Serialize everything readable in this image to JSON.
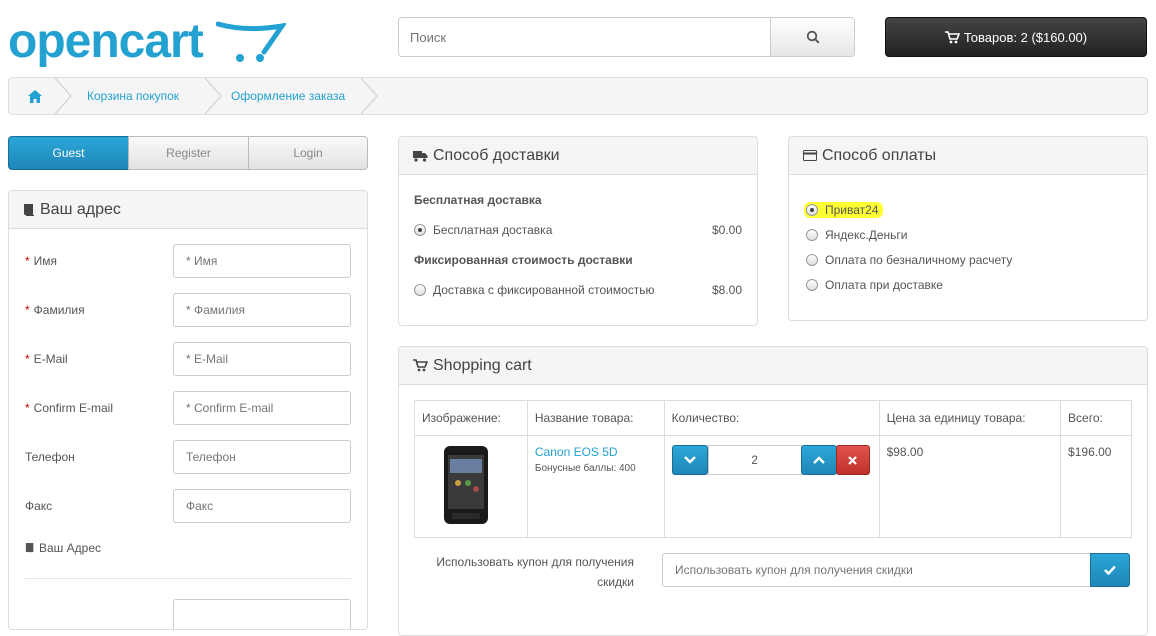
{
  "header": {
    "logo_text": "opencart",
    "search_placeholder": "Поиск",
    "cart_label": "Товаров: 2 ($160.00)"
  },
  "breadcrumb": {
    "items": [
      "Корзина покупок",
      "Оформление заказа"
    ]
  },
  "account_tabs": [
    "Guest",
    "Register",
    "Login"
  ],
  "address_panel": {
    "title": "Ваш адрес",
    "fields": [
      {
        "label": "Имя",
        "placeholder": "* Имя",
        "required": true
      },
      {
        "label": "Фамилия",
        "placeholder": "* Фамилия",
        "required": true
      },
      {
        "label": "E-Mail",
        "placeholder": "* E-Mail",
        "required": true
      },
      {
        "label": "Confirm E-mail",
        "placeholder": "* Confirm E-mail",
        "required": true
      },
      {
        "label": "Телефон",
        "placeholder": "Телефон",
        "required": false
      },
      {
        "label": "Факс",
        "placeholder": "Факс",
        "required": false
      }
    ],
    "address_subtitle": "Ваш Адрес"
  },
  "shipping_panel": {
    "title": "Способ доставки",
    "groups": [
      {
        "title": "Бесплатная доставка",
        "option": "Бесплатная доставка",
        "price": "$0.00",
        "selected": true
      },
      {
        "title": "Фиксированная стоимость доставки",
        "option": "Доставка с фиксированной стоимостью",
        "price": "$8.00",
        "selected": false
      }
    ]
  },
  "payment_panel": {
    "title": "Способ оплаты",
    "options": [
      {
        "label": "Приват24",
        "selected": true
      },
      {
        "label": "Яндекс.Деньги",
        "selected": false
      },
      {
        "label": "Оплата по безналичному расчету",
        "selected": false
      },
      {
        "label": "Оплата при доставке",
        "selected": false
      }
    ]
  },
  "cart_panel": {
    "title": "Shopping cart",
    "headers": [
      "Изображение:",
      "Название товара:",
      "Количество:",
      "Цена за единицу товара:",
      "Всего:"
    ],
    "item": {
      "name": "Canon EOS 5D",
      "bonus": "Бонусные баллы: 400",
      "quantity": "2",
      "unit_price": "$98.00",
      "total": "$196.00"
    },
    "coupon_label": "Использовать купон для получения скидки",
    "coupon_placeholder": "Использовать купон для получения скидки"
  },
  "colors": {
    "brand": "#23a1d1",
    "primary_button": "#1f86b8",
    "danger_button": "#c0302b",
    "highlight": "#ffff33"
  }
}
